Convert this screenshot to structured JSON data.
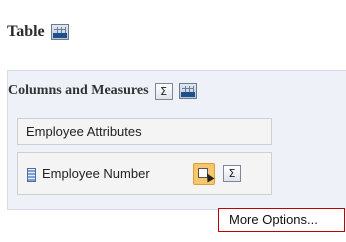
{
  "page": {
    "title": "Table",
    "title_icon": "table-xyz-icon"
  },
  "columns_section": {
    "title": "Columns and Measures",
    "sigma_symbol": "Σ",
    "table_icon": "table-xyz-icon"
  },
  "attributes": {
    "folder_label": "Employee Attributes"
  },
  "column_item": {
    "label": "Employee Number",
    "icon": "attribute-column-icon",
    "options_icon": "column-options-icon",
    "sigma_symbol": "Σ"
  },
  "context_menu": {
    "items": [
      "More Options..."
    ]
  },
  "colors": {
    "panel_bg": "#eef1f7",
    "highlight_button": "#f7c66d",
    "menu_border": "#c00000"
  }
}
